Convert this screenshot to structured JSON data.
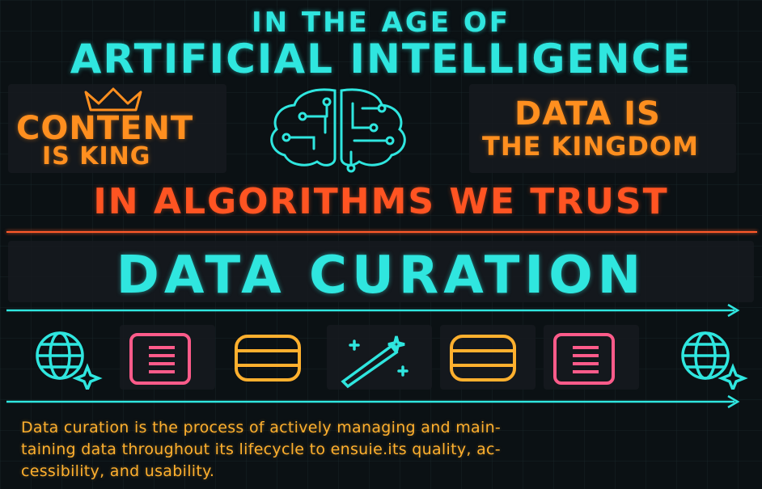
{
  "header": {
    "top_line": "IN THE AGE OF",
    "main_line": "ARTIFICIAL INTELLIGENCE"
  },
  "left_slogan": {
    "line1": "CONTENT",
    "line2": "IS KING"
  },
  "right_slogan": {
    "line1": "DATA IS",
    "line2": "THE KINGDOM"
  },
  "tagline": "IN ALGORITHMS WE TRUST",
  "headline": "DATA CURATION",
  "icons": [
    "globe-icon",
    "document-icon",
    "database-icon",
    "magic-wand-icon",
    "database-icon",
    "document-icon",
    "globe-icon"
  ],
  "description": {
    "line1": "Data curation is the process of actively managing and main-",
    "line2": "taining data throughout its lifecycle to ensuie.its quality, ac-",
    "line3": "cessibility, and usability."
  },
  "colors": {
    "cyan": "#2fe6df",
    "orange": "#ff8f1f",
    "red": "#ff5422",
    "pink": "#ff5b8a",
    "amber": "#ffb02e",
    "background": "#0b1114"
  }
}
